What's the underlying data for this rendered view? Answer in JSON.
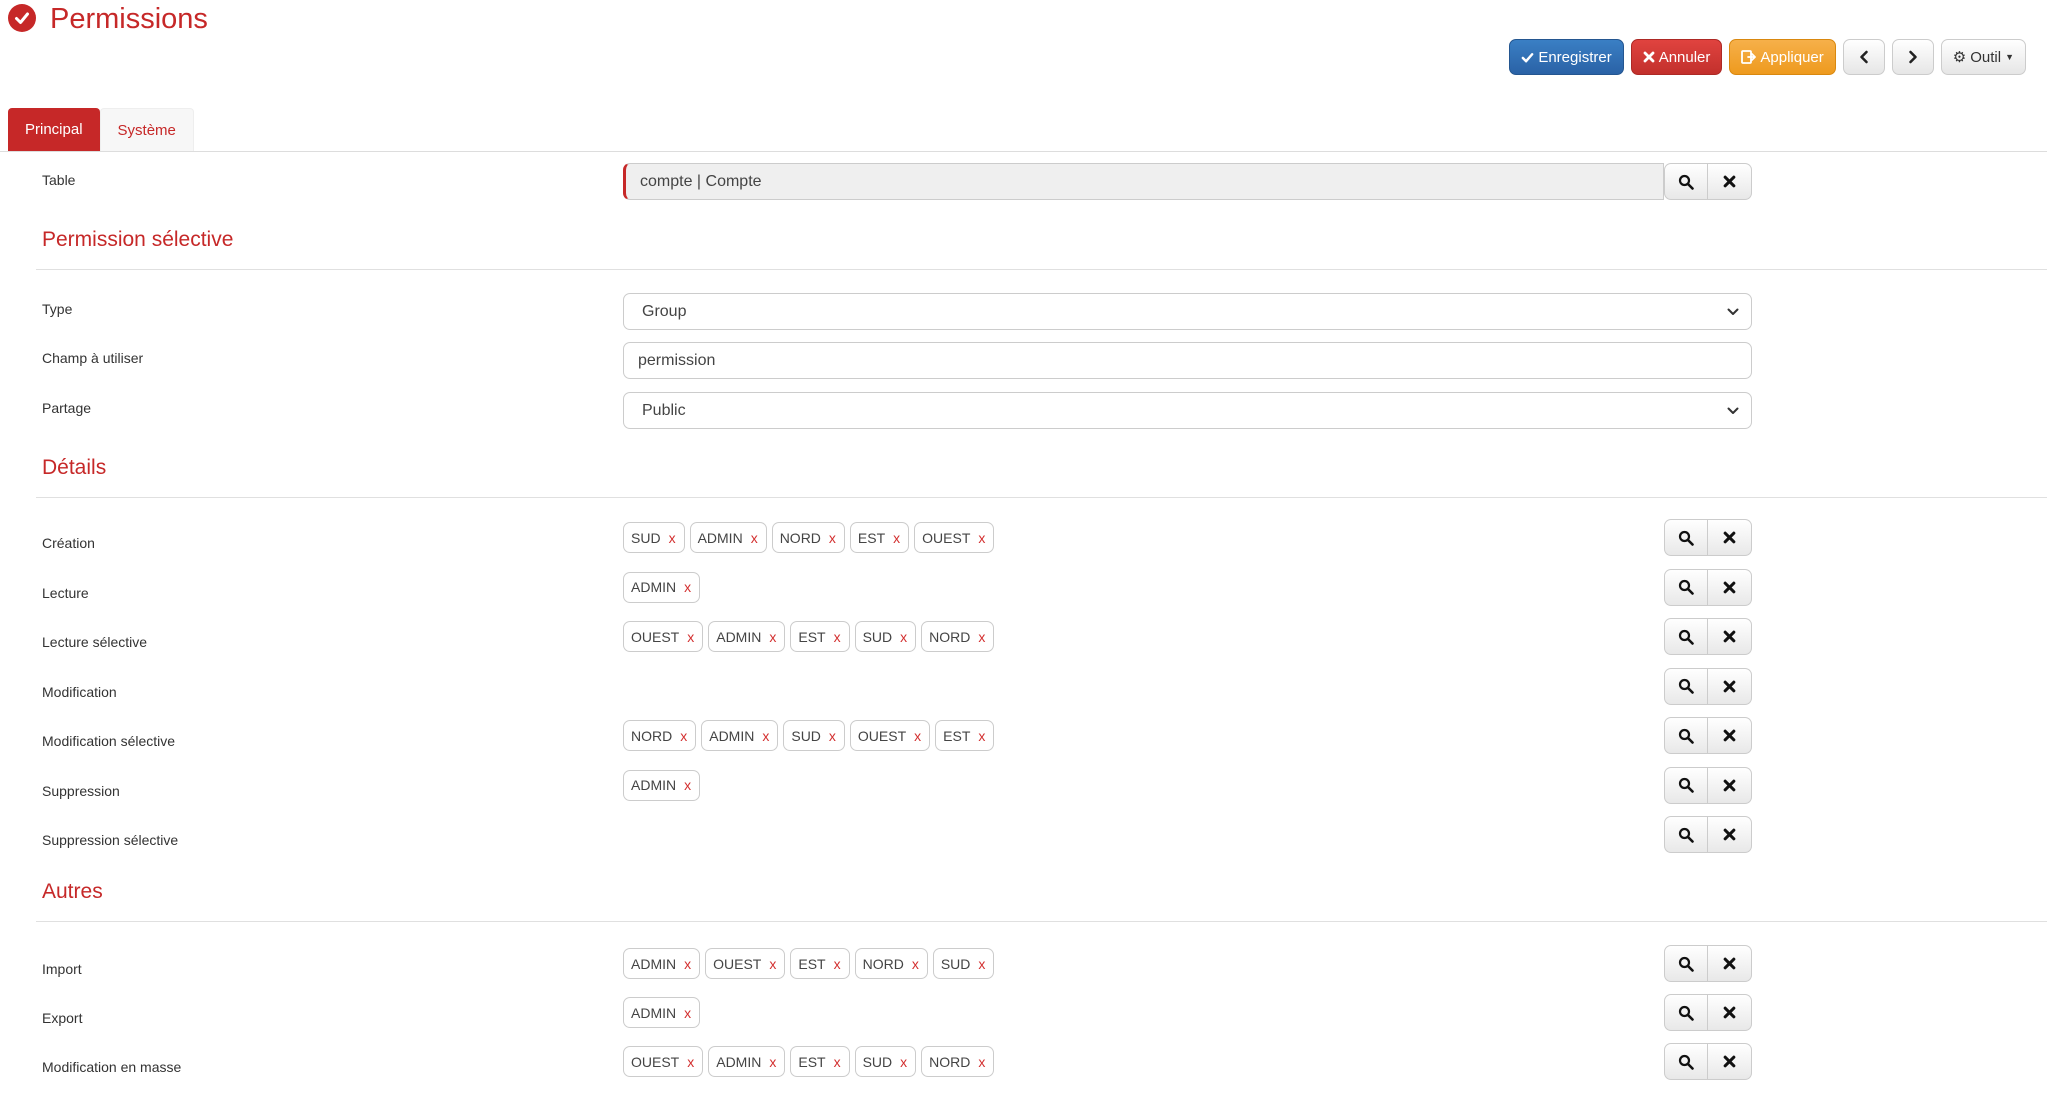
{
  "header": {
    "title": "Permissions",
    "icon": "check-circle-icon",
    "accent": "#c62828"
  },
  "toolbar": {
    "save_label": "Enregistrer",
    "cancel_label": "Annuler",
    "apply_label": "Appliquer",
    "tool_label": "Outil"
  },
  "tabs": [
    {
      "label": "Principal",
      "active": true
    },
    {
      "label": "Système",
      "active": false
    }
  ],
  "table": {
    "label": "Table",
    "value": "compte | Compte"
  },
  "sections": {
    "selective": "Permission sélective",
    "details": "Détails",
    "others": "Autres"
  },
  "selective": {
    "type": {
      "label": "Type",
      "value": "Group"
    },
    "field": {
      "label": "Champ à utiliser",
      "value": "permission"
    },
    "sharing": {
      "label": "Partage",
      "value": "Public"
    }
  },
  "details": [
    {
      "label": "Création",
      "tags": [
        "SUD",
        "ADMIN",
        "NORD",
        "EST",
        "OUEST"
      ]
    },
    {
      "label": "Lecture",
      "tags": [
        "ADMIN"
      ]
    },
    {
      "label": "Lecture sélective",
      "tags": [
        "OUEST",
        "ADMIN",
        "EST",
        "SUD",
        "NORD"
      ]
    },
    {
      "label": "Modification",
      "tags": []
    },
    {
      "label": "Modification sélective",
      "tags": [
        "NORD",
        "ADMIN",
        "SUD",
        "OUEST",
        "EST"
      ]
    },
    {
      "label": "Suppression",
      "tags": [
        "ADMIN"
      ]
    },
    {
      "label": "Suppression sélective",
      "tags": []
    }
  ],
  "others": [
    {
      "label": "Import",
      "tags": [
        "ADMIN",
        "OUEST",
        "EST",
        "NORD",
        "SUD"
      ]
    },
    {
      "label": "Export",
      "tags": [
        "ADMIN"
      ]
    },
    {
      "label": "Modification en masse",
      "tags": [
        "OUEST",
        "ADMIN",
        "EST",
        "SUD",
        "NORD"
      ]
    }
  ],
  "tag_remove": "x"
}
